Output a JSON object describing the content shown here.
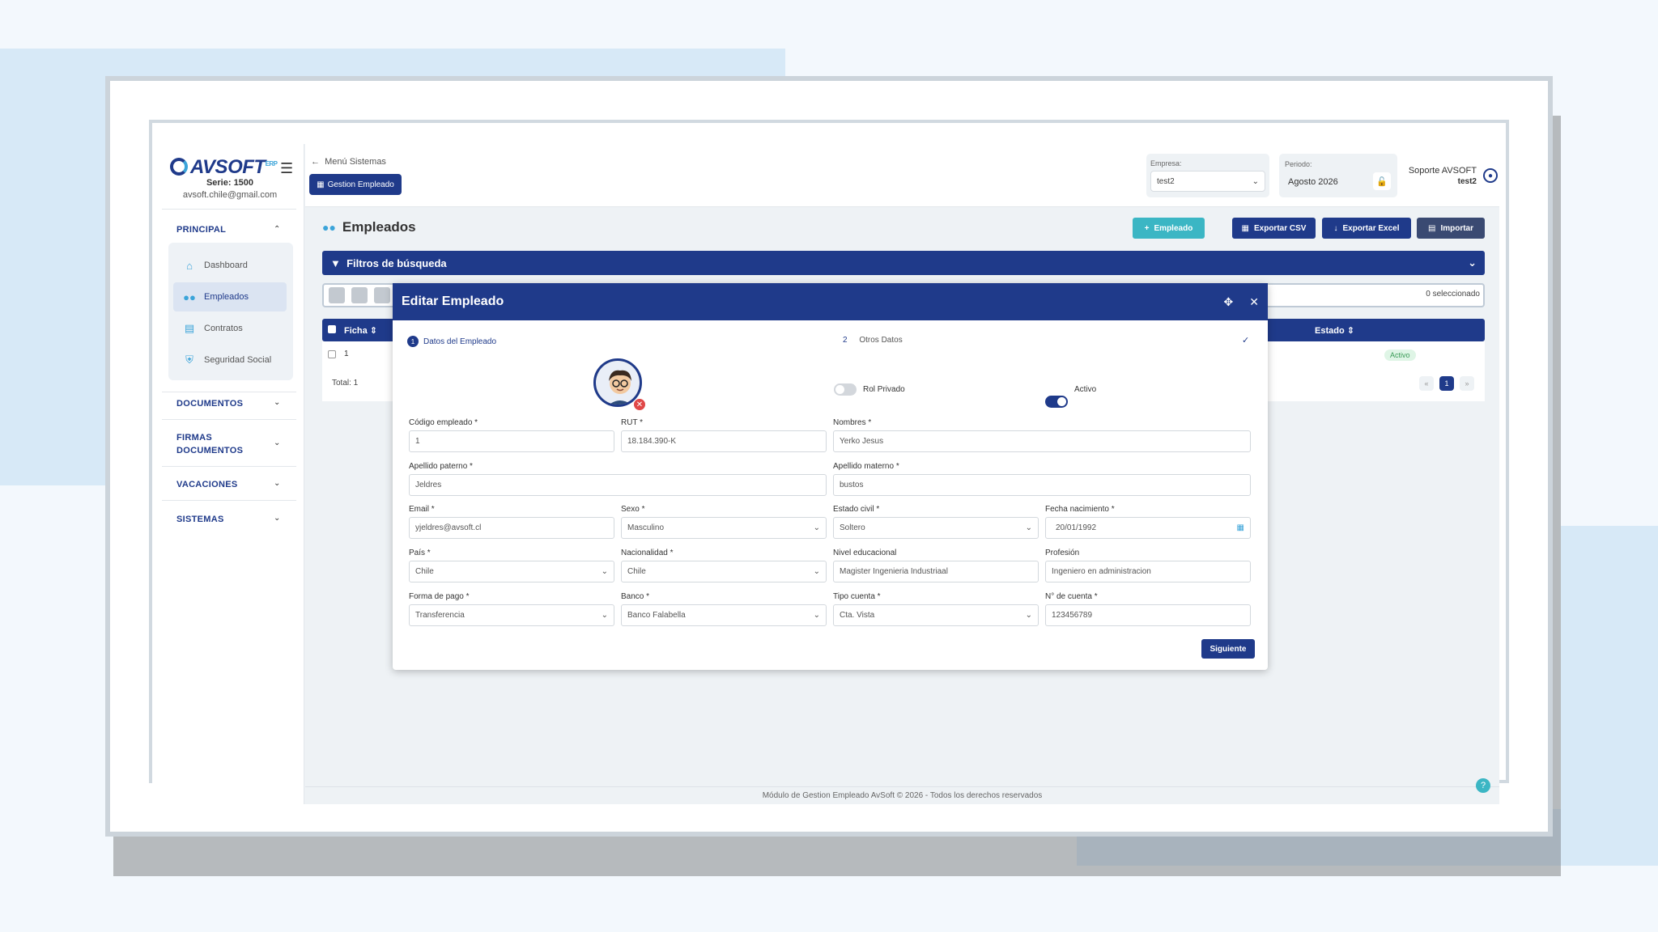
{
  "brand": {
    "name": "AVSOFT",
    "suffix": "ERP",
    "serie": "Serie: 1500",
    "email": "avsoft.chile@gmail.com"
  },
  "sidebar": {
    "principal": "PRINCIPAL",
    "items": [
      {
        "label": "Dashboard",
        "icon": "home-icon"
      },
      {
        "label": "Empleados",
        "icon": "users-icon"
      },
      {
        "label": "Contratos",
        "icon": "file-icon"
      },
      {
        "label": "Seguridad Social",
        "icon": "shield-icon"
      }
    ],
    "documentos": "DOCUMENTOS",
    "firmas_1": "FIRMAS",
    "firmas_2": "DOCUMENTOS",
    "vacaciones": "VACACIONES",
    "sistemas": "SISTEMAS"
  },
  "topbar": {
    "back": "Menú Sistemas",
    "module": "Gestion Empleado",
    "empresa_label": "Empresa:",
    "empresa_value": "test2",
    "periodo_label": "Periodo:",
    "periodo_value": "Agosto 2026",
    "user": "Soporte AVSOFT",
    "user_sub": "test2"
  },
  "page": {
    "title": "Empleados",
    "btn_empleado": "Empleado",
    "btn_csv": "Exportar CSV",
    "btn_excel": "Exportar Excel",
    "btn_importar": "Importar",
    "filters": "Filtros de búsqueda",
    "selected": "0 seleccionado",
    "col_ficha": "Ficha",
    "col_estado": "Estado",
    "row_ficha": "1",
    "row_estado": "Activo",
    "total": "Total: 1",
    "page": "1"
  },
  "modal": {
    "title": "Editar Empleado",
    "step1_num": "1",
    "step1": "Datos del Empleado",
    "step2_num": "2",
    "step2": "Otros Datos",
    "rol_privado": "Rol Privado",
    "activo": "Activo",
    "fields": {
      "codigo": {
        "label": "Código empleado *",
        "value": "1"
      },
      "rut": {
        "label": "RUT *",
        "value": "18.184.390-K"
      },
      "nombres": {
        "label": "Nombres *",
        "value": "Yerko Jesus"
      },
      "ap_paterno": {
        "label": "Apellido paterno *",
        "value": "Jeldres"
      },
      "ap_materno": {
        "label": "Apellido materno *",
        "value": "bustos"
      },
      "email": {
        "label": "Email *",
        "value": "yjeldres@avsoft.cl"
      },
      "sexo": {
        "label": "Sexo *",
        "value": "Masculino"
      },
      "estado_civil": {
        "label": "Estado civil *",
        "value": "Soltero"
      },
      "fecha_nac": {
        "label": "Fecha nacimiento *",
        "value": "20/01/1992"
      },
      "pais": {
        "label": "País *",
        "value": "Chile"
      },
      "nacionalidad": {
        "label": "Nacionalidad *",
        "value": "Chile"
      },
      "nivel_edu": {
        "label": "Nivel educacional",
        "value": "Magister Ingenieria Industriaal"
      },
      "profesion": {
        "label": "Profesión",
        "value": "Ingeniero en administracion"
      },
      "forma_pago": {
        "label": "Forma de pago *",
        "value": "Transferencia"
      },
      "banco": {
        "label": "Banco *",
        "value": "Banco Falabella"
      },
      "tipo_cuenta": {
        "label": "Tipo cuenta *",
        "value": "Cta. Vista"
      },
      "num_cuenta": {
        "label": "N° de cuenta *",
        "value": "123456789"
      }
    },
    "next": "Siguiente"
  },
  "footer": "Módulo de Gestion Empleado AvSoft © 2026 - Todos los derechos reservados",
  "colors": {
    "primary": "#1f3a8a",
    "accent": "#3ba4d9",
    "teal": "#3bb6c4",
    "success": "#3a9b57"
  }
}
